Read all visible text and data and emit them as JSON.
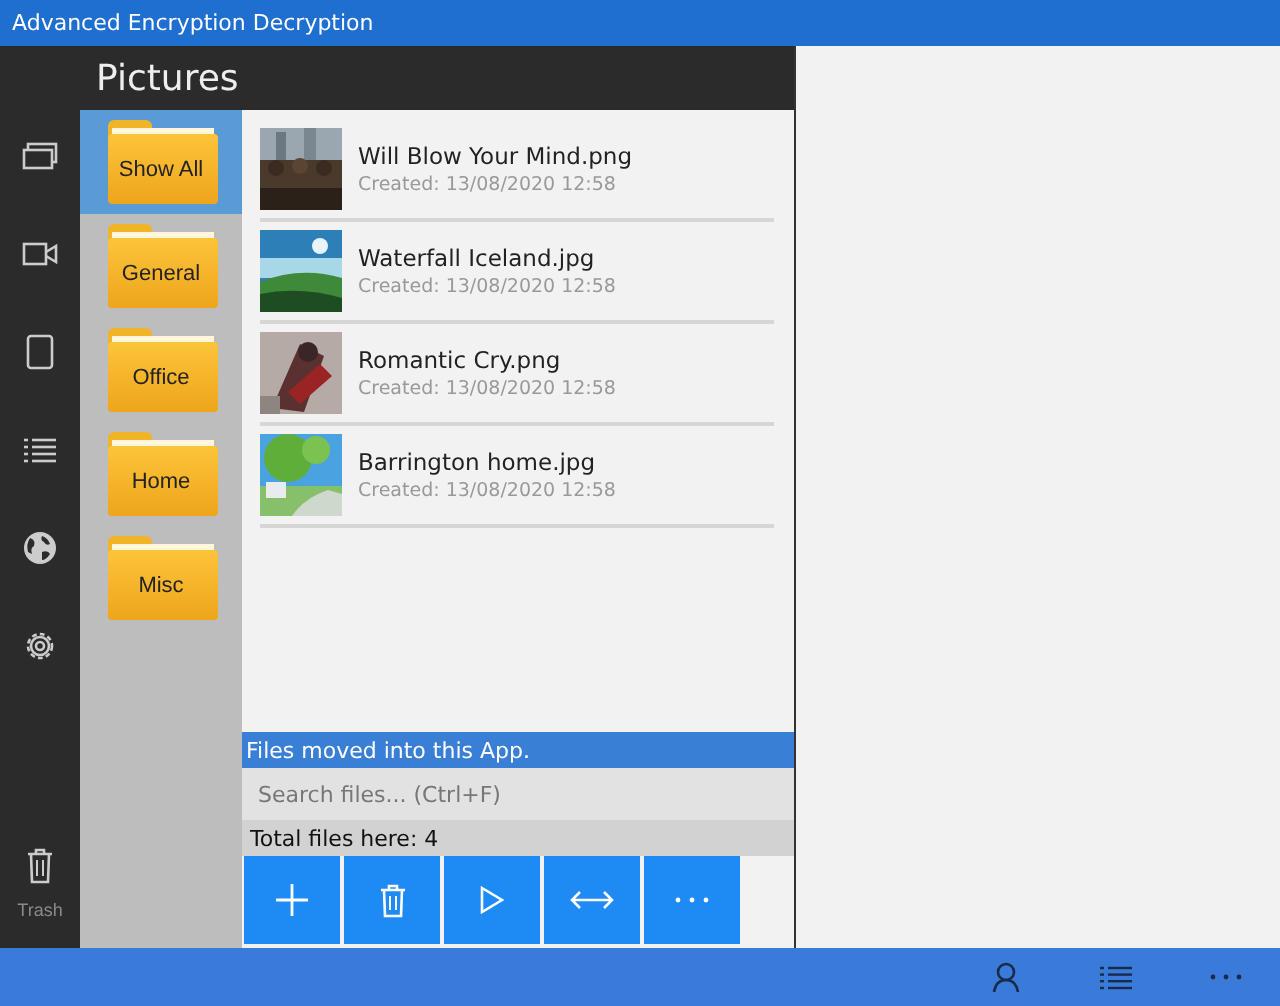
{
  "window": {
    "title": "Advanced Encryption Decryption"
  },
  "rail": [
    {
      "kind": "pictures"
    },
    {
      "kind": "video"
    },
    {
      "kind": "document"
    },
    {
      "kind": "list"
    },
    {
      "kind": "globe"
    },
    {
      "kind": "settings"
    }
  ],
  "trash": {
    "label": "Trash"
  },
  "header": {
    "title": "Pictures"
  },
  "folders": [
    {
      "label": "Show All",
      "selected": true
    },
    {
      "label": "General",
      "selected": false
    },
    {
      "label": "Office",
      "selected": false
    },
    {
      "label": "Home",
      "selected": false
    },
    {
      "label": "Misc",
      "selected": false
    }
  ],
  "files": [
    {
      "name": "Will Blow Your Mind.png",
      "created": "Created: 13/08/2020 12:58"
    },
    {
      "name": "Waterfall Iceland.jpg",
      "created": "Created: 13/08/2020 12:58"
    },
    {
      "name": "Romantic Cry.png",
      "created": "Created: 13/08/2020 12:58"
    },
    {
      "name": "Barrington home.jpg",
      "created": "Created: 13/08/2020 12:58"
    }
  ],
  "status": "Files moved into this App.",
  "search": {
    "placeholder": "Search files... (Ctrl+F)"
  },
  "total": "Total files here: 4",
  "actions": [
    {
      "kind": "add"
    },
    {
      "kind": "delete"
    },
    {
      "kind": "play"
    },
    {
      "kind": "move"
    },
    {
      "kind": "more"
    }
  ],
  "bottom_bar": [
    {
      "kind": "account"
    },
    {
      "kind": "list"
    },
    {
      "kind": "more"
    }
  ]
}
